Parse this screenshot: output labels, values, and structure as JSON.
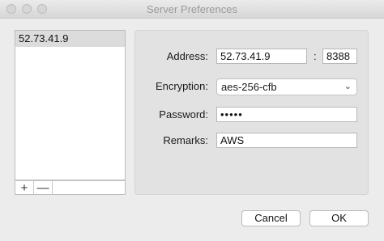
{
  "window": {
    "title": "Server Preferences"
  },
  "servers": {
    "items": [
      {
        "label": "52.73.41.9"
      }
    ]
  },
  "list_toolbar": {
    "add_label": "+",
    "remove_label": "—"
  },
  "form": {
    "address": {
      "label": "Address:",
      "value": "52.73.41.9",
      "separator": ":",
      "port": "8388"
    },
    "encryption": {
      "label": "Encryption:",
      "value": "aes-256-cfb",
      "icon": "chevron-down-icon"
    },
    "password": {
      "label": "Password:",
      "value": "•••••"
    },
    "remarks": {
      "label": "Remarks:",
      "value": "AWS"
    }
  },
  "buttons": {
    "cancel": "Cancel",
    "ok": "OK"
  }
}
